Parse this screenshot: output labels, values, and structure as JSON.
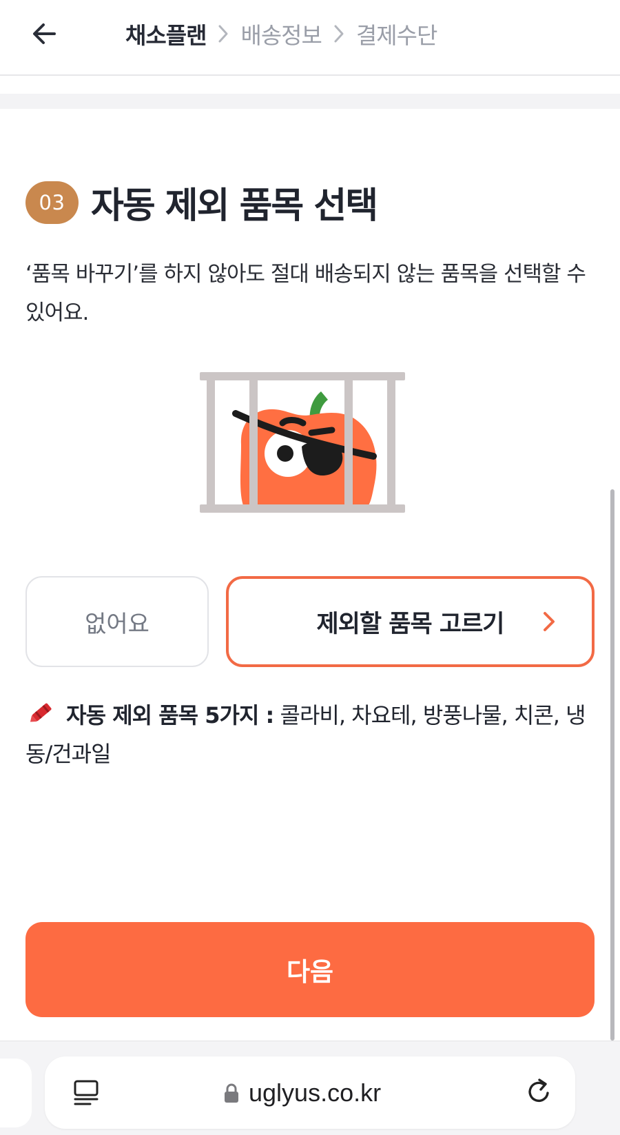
{
  "header": {
    "steps": [
      {
        "label": "채소플랜",
        "state": "active"
      },
      {
        "label": "배송정보",
        "state": "inactive"
      },
      {
        "label": "결제수단",
        "state": "inactive"
      }
    ]
  },
  "section": {
    "badge": "03",
    "title": "자동 제외 품목 선택",
    "description": "‘품목 바꾸기’를 하지 않아도 절대 배송되지 않는 품목을 선택할 수 있어요."
  },
  "options": {
    "none_label": "없어요",
    "pick_label": "제외할 품목 고르기"
  },
  "notice": {
    "label": "자동 제외 품목 5가지 :",
    "items": "콜라비, 차요테, 방풍나물, 치콘, 냉동/건과일"
  },
  "next_button": "다음",
  "browser": {
    "url": "uglyus.co.kr"
  },
  "colors": {
    "accent": "#fd6b42",
    "badge": "#c9884e",
    "pick_border": "#f26a45"
  },
  "icons": [
    "back-arrow-icon",
    "chevron-right-icon",
    "crayon-icon",
    "reader-icon",
    "lock-icon",
    "reload-icon"
  ]
}
